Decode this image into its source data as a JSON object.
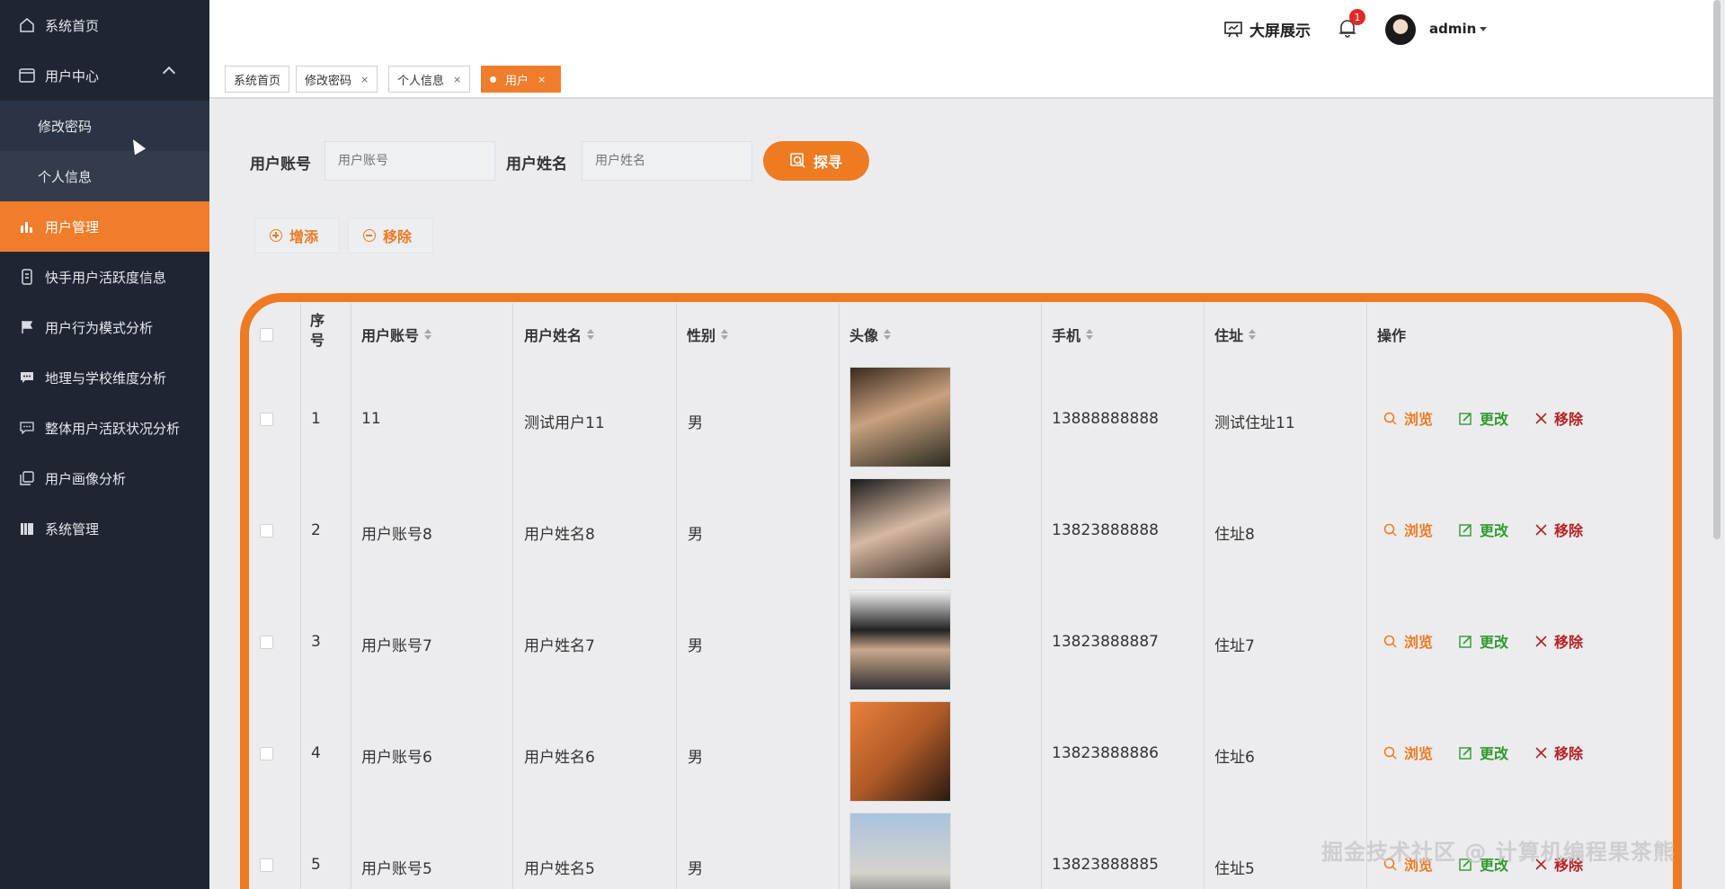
{
  "sidebar": {
    "items": [
      {
        "label": "系统首页",
        "icon": "home-icon"
      },
      {
        "label": "用户中心",
        "icon": "card-icon"
      },
      {
        "label": "修改密码"
      },
      {
        "label": "个人信息"
      },
      {
        "label": "用户管理",
        "icon": "bar-chart-icon"
      },
      {
        "label": "快手用户活跃度信息",
        "icon": "phone-icon"
      },
      {
        "label": "用户行为模式分析",
        "icon": "flag-icon"
      },
      {
        "label": "地理与学校维度分析",
        "icon": "chat-icon"
      },
      {
        "label": "整体用户活跃状况分析",
        "icon": "message-icon"
      },
      {
        "label": "用户画像分析",
        "icon": "copy-icon"
      },
      {
        "label": "系统管理",
        "icon": "book-icon"
      }
    ]
  },
  "header": {
    "bigscreen": "大屏展示",
    "notification_count": "1",
    "username": "admin"
  },
  "tabs": [
    {
      "label": "系统首页",
      "close": ""
    },
    {
      "label": "修改密码",
      "close": "×"
    },
    {
      "label": "个人信息",
      "close": "×"
    },
    {
      "label": "用户",
      "close": "×"
    }
  ],
  "search": {
    "account_label": "用户账号",
    "account_placeholder": "用户账号",
    "name_label": "用户姓名",
    "name_placeholder": "用户姓名",
    "button": "探寻"
  },
  "toolbar": {
    "add": "增添",
    "remove": "移除"
  },
  "table": {
    "headers": {
      "index": "序号",
      "account": "用户账号",
      "name": "用户姓名",
      "gender": "性别",
      "avatar": "头像",
      "phone": "手机",
      "address": "住址",
      "actions": "操作"
    },
    "rows": [
      {
        "index": "1",
        "account": "11",
        "name": "测试用户11",
        "gender": "男",
        "phone": "13888888888",
        "address": "测试住址11"
      },
      {
        "index": "2",
        "account": "用户账号8",
        "name": "用户姓名8",
        "gender": "男",
        "phone": "13823888888",
        "address": "住址8"
      },
      {
        "index": "3",
        "account": "用户账号7",
        "name": "用户姓名7",
        "gender": "男",
        "phone": "13823888887",
        "address": "住址7"
      },
      {
        "index": "4",
        "account": "用户账号6",
        "name": "用户姓名6",
        "gender": "男",
        "phone": "13823888886",
        "address": "住址6"
      },
      {
        "index": "5",
        "account": "用户账号5",
        "name": "用户姓名5",
        "gender": "男",
        "phone": "13823888885",
        "address": "住址5"
      }
    ],
    "actions": {
      "view": "浏览",
      "edit": "更改",
      "delete": "移除"
    }
  },
  "watermark": "掘金技术社区 @ 计算机编程果茶熊",
  "colors": {
    "accent": "#ee7a22",
    "sidebar_bg": "#1f2632",
    "edit_green": "#2f9a2f",
    "delete_red": "#b52121"
  }
}
